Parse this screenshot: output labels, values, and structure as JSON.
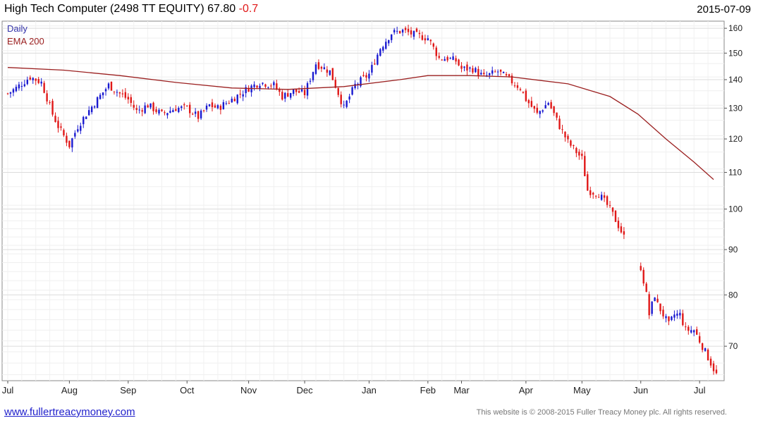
{
  "header": {
    "title": "High Tech Computer (2498 TT EQUITY)",
    "last": "67.80",
    "change": "-0.7",
    "date": "2015-07-09"
  },
  "footer": {
    "site": "www.fullertreacymoney.com",
    "copyright": "This website is © 2008-2015 Fuller Treacy Money plc. All rights reserved."
  },
  "colors": {
    "up": "#1a1ad0",
    "down": "#e01818",
    "ema": "#9b2020",
    "grid": "#dcdcdc"
  },
  "chart_data": {
    "type": "line",
    "legend": [
      "Daily",
      "EMA 200"
    ],
    "legend_position": "top-left",
    "y_scale": "log",
    "ylim": [
      64,
      163
    ],
    "y_ticks": [
      70,
      80,
      90,
      100,
      110,
      120,
      130,
      140,
      150,
      160
    ],
    "x_tick_labels": [
      "Jul",
      "Aug",
      "Sep",
      "Oct",
      "Nov",
      "Dec",
      "Jan",
      "Feb",
      "Mar",
      "Apr",
      "May",
      "Jun",
      "Jul"
    ],
    "x_tick_index": [
      0,
      22,
      43,
      64,
      86,
      106,
      129,
      150,
      162,
      185,
      205,
      226,
      247
    ],
    "n_days": 254,
    "grid": true,
    "series": [
      {
        "name": "Daily",
        "kind": "ohlc-bars",
        "anchors_index": [
          0,
          3,
          8,
          12,
          16,
          18,
          22,
          25,
          28,
          32,
          36,
          40,
          43,
          46,
          50,
          55,
          60,
          64,
          68,
          72,
          75,
          80,
          86,
          90,
          95,
          98,
          102,
          106,
          110,
          115,
          120,
          124,
          129,
          133,
          137,
          141,
          146,
          150,
          154,
          157,
          160,
          162,
          166,
          170,
          175,
          179,
          183,
          185,
          189,
          193,
          197,
          200,
          205,
          207,
          211,
          215,
          220,
          224,
          226,
          228,
          229,
          230,
          231,
          232,
          233,
          236,
          238,
          240,
          242,
          245,
          247,
          250,
          253
        ],
        "anchors_close": [
          135,
          137,
          141,
          139,
          128,
          124,
          118,
          124,
          128,
          133,
          138,
          135,
          133,
          129,
          131,
          128,
          130,
          130,
          127,
          131,
          130,
          133,
          137,
          139,
          138,
          134,
          136,
          135,
          146,
          143,
          130,
          138,
          142,
          152,
          158,
          159,
          157,
          156,
          148,
          148,
          147,
          144,
          144,
          141,
          143,
          140,
          137,
          133,
          128,
          132,
          124,
          119,
          114,
          105,
          104,
          100,
          93,
          86,
          86,
          80,
          76,
          78,
          80,
          78,
          77,
          74,
          76,
          76,
          73,
          73,
          71,
          68,
          65
        ]
      },
      {
        "name": "EMA 200",
        "kind": "line",
        "x_index": [
          0,
          20,
          40,
          60,
          80,
          100,
          120,
          140,
          150,
          165,
          180,
          200,
          215,
          225,
          235,
          245,
          252
        ],
        "values": [
          144.5,
          143.5,
          141.5,
          139,
          137,
          136.5,
          137.5,
          140,
          141.5,
          141.5,
          141,
          138.5,
          134,
          128,
          120,
          113,
          108
        ]
      }
    ]
  }
}
